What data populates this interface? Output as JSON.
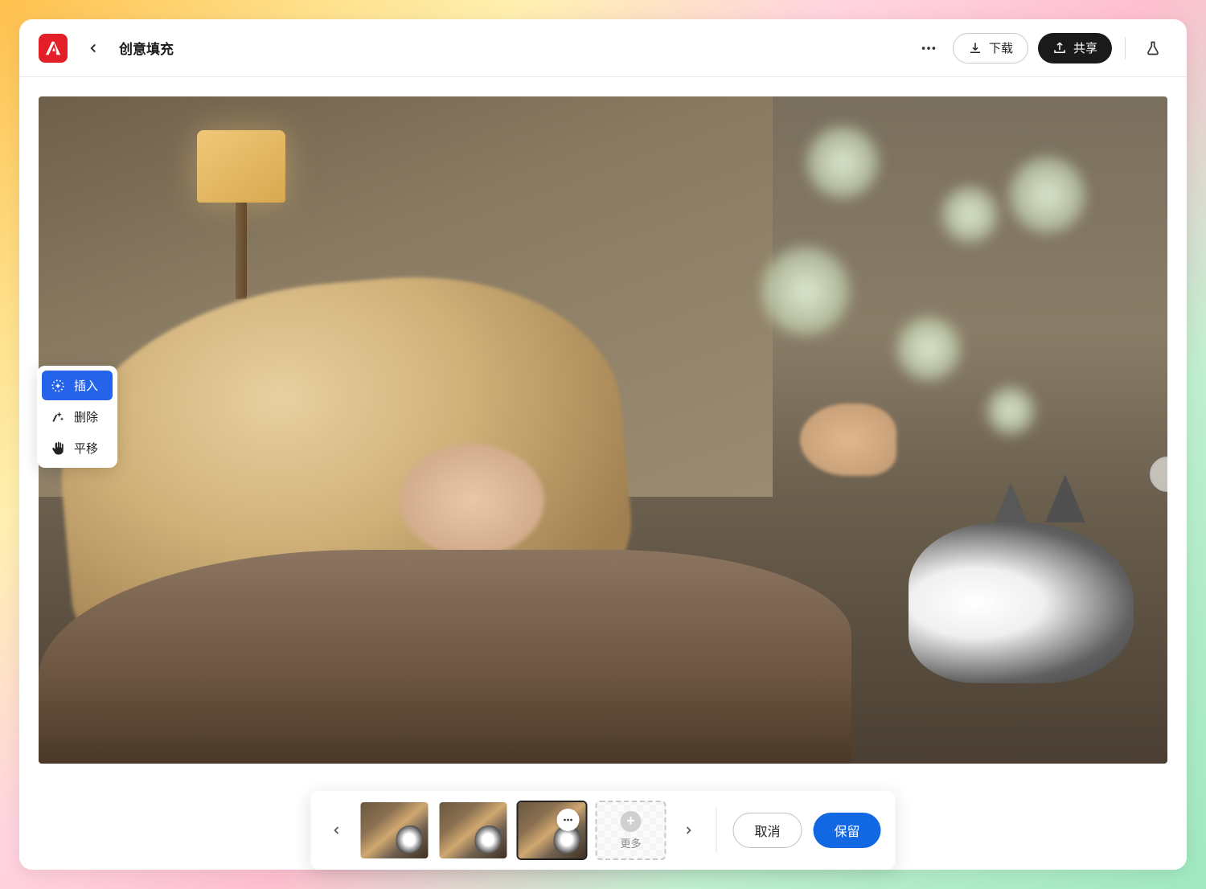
{
  "header": {
    "page_title": "创意填充",
    "download_label": "下载",
    "share_label": "共享"
  },
  "tools": {
    "insert": "插入",
    "delete": "删除",
    "pan": "平移"
  },
  "bottom": {
    "more_label": "更多",
    "cancel_label": "取消",
    "keep_label": "保留"
  },
  "thumbnails": {
    "count": 3,
    "selected_index": 2
  }
}
